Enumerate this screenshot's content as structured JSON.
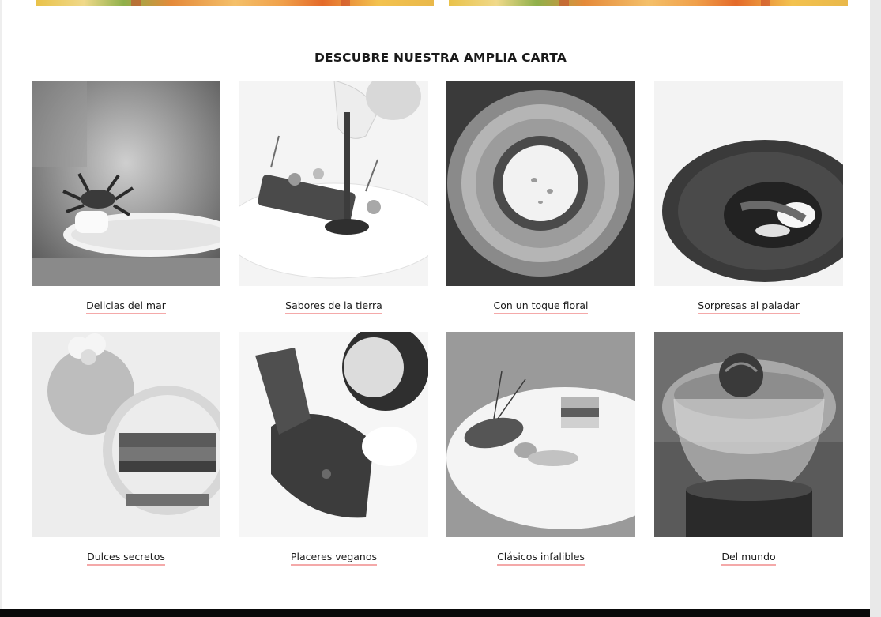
{
  "section": {
    "title": "DESCUBRE NUESTRA AMPLIA CARTA"
  },
  "categories": [
    {
      "label": "Delicias del mar",
      "icon": "crab-dish-photo"
    },
    {
      "label": "Sabores de la tierra",
      "icon": "sauce-pour-photo"
    },
    {
      "label": "Con un toque floral",
      "icon": "sunflower-photo"
    },
    {
      "label": "Sorpresas al paladar",
      "icon": "bowl-photo"
    },
    {
      "label": "Dulces secretos",
      "icon": "dessert-spheres-photo"
    },
    {
      "label": "Placeres veganos",
      "icon": "chocolate-shell-photo"
    },
    {
      "label": "Clásicos infalibles",
      "icon": "plated-meat-photo"
    },
    {
      "label": "Del mundo",
      "icon": "glass-bowl-photo"
    }
  ],
  "colors": {
    "caption_underline": "#f4a9a9",
    "footer": "#0a0a0a",
    "text": "#1a1a1a"
  }
}
